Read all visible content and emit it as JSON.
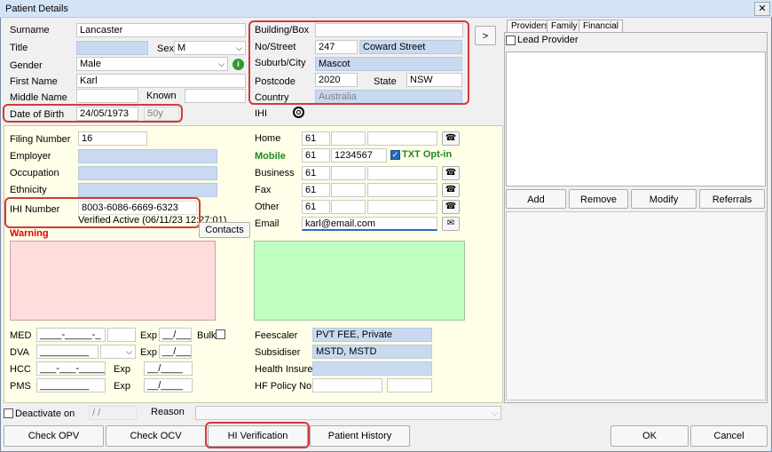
{
  "window": {
    "title": "Patient Details",
    "close": "✕"
  },
  "demo": {
    "surname_label": "Surname",
    "surname": "Lancaster",
    "title_label": "Title",
    "title": "",
    "sex_label": "Sex",
    "sex": "M",
    "gender_label": "Gender",
    "gender": "Male",
    "first_label": "First Name",
    "first": "Karl",
    "middle_label": "Middle Name",
    "middle": "",
    "known_label": "Known",
    "known": "",
    "dob_label": "Date of Birth",
    "dob": "24/05/1973",
    "age": "50y"
  },
  "address": {
    "building_label": "Building/Box",
    "building": "",
    "street_label": "No/Street",
    "street_no": "247",
    "street": "Coward Street",
    "suburb_label": "Suburb/City",
    "suburb": "Mascot",
    "postcode_label": "Postcode",
    "postcode": "2020",
    "state_label": "State",
    "state": "NSW",
    "country_label": "Country",
    "country": "Australia",
    "ihi_label": "IHI",
    "more_button": ">"
  },
  "details": {
    "filing_label": "Filing Number",
    "filing": "16",
    "employer_label": "Employer",
    "occupation_label": "Occupation",
    "ethnicity_label": "Ethnicity",
    "ihi_number_label": "IHI Number",
    "ihi_number": "8003-6086-6669-6323",
    "ihi_status": "Verified Active (06/11/23 12:27:01)",
    "warning_label": "Warning",
    "contacts_button": "Contacts"
  },
  "phones": {
    "home_label": "Home",
    "home_code": "61",
    "mobile_label": "Mobile",
    "mobile_code": "61",
    "mobile": "1234567",
    "txt_optin": "TXT Opt-in",
    "business_label": "Business",
    "business_code": "61",
    "fax_label": "Fax",
    "fax_code": "61",
    "other_label": "Other",
    "other_code": "61",
    "email_label": "Email",
    "email": "karl@email.com"
  },
  "cards": {
    "med_label": "MED",
    "med": "____-_____-_",
    "exp_label": "Exp",
    "med_exp": "__/____",
    "bulk_label": "Bulk",
    "dva_label": "DVA",
    "dva": "_________",
    "dva_exp": "__/____",
    "hcc_label": "HCC",
    "hcc": "___-___-_____",
    "hcc_exp": "__/____",
    "pms_label": "PMS",
    "pms": "_________",
    "pms_exp": "__/____"
  },
  "billing": {
    "feescaler_label": "Feescaler",
    "feescaler": "PVT FEE, Private",
    "subsidiser_label": "Subsidiser",
    "subsidiser": "MSTD, MSTD",
    "health_insurer_label": "Health Insurer",
    "hf_policy_label": "HF Policy No."
  },
  "footer": {
    "deactivate_label": "Deactivate on",
    "deactivate_date": "/ /",
    "reason_label": "Reason"
  },
  "right": {
    "tabs": [
      "Providers",
      "Family",
      "Financial"
    ],
    "lead_provider": "Lead Provider",
    "add": "Add",
    "remove": "Remove",
    "modify": "Modify",
    "referrals": "Referrals"
  },
  "buttons": {
    "check_opv": "Check OPV",
    "check_ocv": "Check OCV",
    "hi_verification": "HI Verification",
    "patient_history": "Patient History",
    "ok": "OK",
    "cancel": "Cancel"
  },
  "colors": {
    "highlight": "#d33a3a",
    "mobile": "#1c8a1c",
    "warning": "#e00000"
  }
}
